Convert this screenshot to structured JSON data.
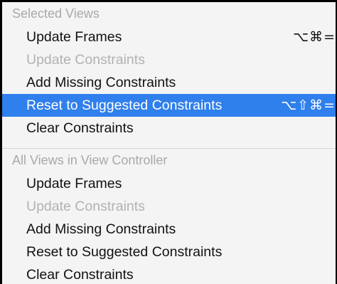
{
  "menu": {
    "sections": [
      {
        "header": "Selected Views",
        "items": [
          {
            "label": "Update Frames",
            "shortcut": "⌥⌘=",
            "disabled": false,
            "highlighted": false
          },
          {
            "label": "Update Constraints",
            "shortcut": "",
            "disabled": true,
            "highlighted": false
          },
          {
            "label": "Add Missing Constraints",
            "shortcut": "",
            "disabled": false,
            "highlighted": false
          },
          {
            "label": "Reset to Suggested Constraints",
            "shortcut": "⌥⇧⌘=",
            "disabled": false,
            "highlighted": true
          },
          {
            "label": "Clear Constraints",
            "shortcut": "",
            "disabled": false,
            "highlighted": false
          }
        ]
      },
      {
        "header": "All Views in View Controller",
        "items": [
          {
            "label": "Update Frames",
            "shortcut": "",
            "disabled": false,
            "highlighted": false
          },
          {
            "label": "Update Constraints",
            "shortcut": "",
            "disabled": true,
            "highlighted": false
          },
          {
            "label": "Add Missing Constraints",
            "shortcut": "",
            "disabled": false,
            "highlighted": false
          },
          {
            "label": "Reset to Suggested Constraints",
            "shortcut": "",
            "disabled": false,
            "highlighted": false
          },
          {
            "label": "Clear Constraints",
            "shortcut": "",
            "disabled": false,
            "highlighted": false
          }
        ]
      }
    ],
    "colors": {
      "highlight": "#2f7fec",
      "disabled_text": "#b2b2b2",
      "header_text": "#a9a9a9",
      "background": "#f4f4f4"
    }
  }
}
